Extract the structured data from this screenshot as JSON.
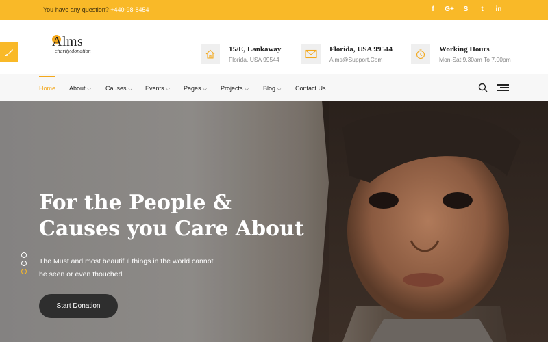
{
  "colors": {
    "accent": "#f9b928",
    "dark": "#2e2e2e",
    "nav_bg": "#f7f7f7"
  },
  "topbar": {
    "question": "You have any question?",
    "phone": "+440-98-8454",
    "socials": [
      {
        "icon": "facebook-icon",
        "glyph": "f"
      },
      {
        "icon": "google-plus-icon",
        "glyph": "G+"
      },
      {
        "icon": "skype-icon",
        "glyph": "S"
      },
      {
        "icon": "twitter-icon",
        "glyph": "t"
      },
      {
        "icon": "linkedin-icon",
        "glyph": "in"
      }
    ]
  },
  "logo": {
    "name": "Alms",
    "tagline": "charity,donation"
  },
  "info": [
    {
      "icon": "home-icon",
      "title": "15/E, Lankaway",
      "sub": "Florida, USA 99544"
    },
    {
      "icon": "mail-icon",
      "title": "Florida, USA 99544",
      "sub": "Alms@Support.Com"
    },
    {
      "icon": "clock-icon",
      "title": "Working Hours",
      "sub": "Mon-Sat:9.30am To 7.00pm"
    }
  ],
  "nav": {
    "items": [
      {
        "label": "Home",
        "caret": false,
        "active": true
      },
      {
        "label": "About",
        "caret": true
      },
      {
        "label": "Causes",
        "caret": true
      },
      {
        "label": "Events",
        "caret": true
      },
      {
        "label": "Pages",
        "caret": true
      },
      {
        "label": "Projects",
        "caret": true
      },
      {
        "label": "Blog",
        "caret": true
      },
      {
        "label": "Contact Us",
        "caret": false
      }
    ],
    "search_icon": "search-icon",
    "menu_icon": "hamburger-icon"
  },
  "hero": {
    "headline_line1": "For the People &",
    "headline_line2": "Causes you Care About",
    "copy_line1": "The Must and most beautiful things in the world cannot",
    "copy_line2": "be seen or even thouched",
    "cta": "Start Donation",
    "slides": 3,
    "active_slide": 3
  }
}
